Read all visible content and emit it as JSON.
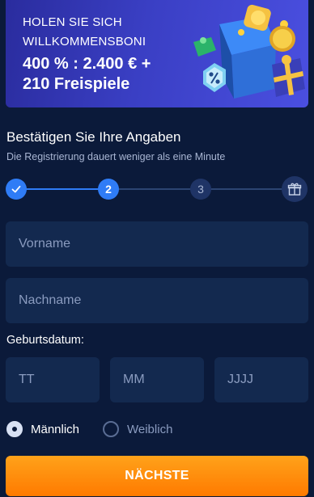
{
  "banner": {
    "line1": "HOLEN SIE SICH",
    "line2": "WILLKOMMENSBONI",
    "amount": "400 % : 2.400 € +",
    "spins": "210 Freispiele"
  },
  "form": {
    "title": "Bestätigen Sie Ihre Angaben",
    "subtitle": "Die Registrierung dauert weniger als eine Minute",
    "steps": {
      "current": "2",
      "third": "3",
      "completed_icon": "check-icon",
      "final_icon": "gift-icon"
    },
    "first_name_placeholder": "Vorname",
    "last_name_placeholder": "Nachname",
    "birthdate_label": "Geburtsdatum:",
    "day_placeholder": "TT",
    "month_placeholder": "MM",
    "year_placeholder": "JJJJ",
    "gender": {
      "male": "Männlich",
      "female": "Weiblich",
      "selected": "male"
    },
    "next_label": "NÄCHSTE"
  },
  "colors": {
    "background": "#0b1a3a",
    "field": "#13294f",
    "accent_blue": "#2f7cf6",
    "button_orange": "#ff8a00"
  }
}
